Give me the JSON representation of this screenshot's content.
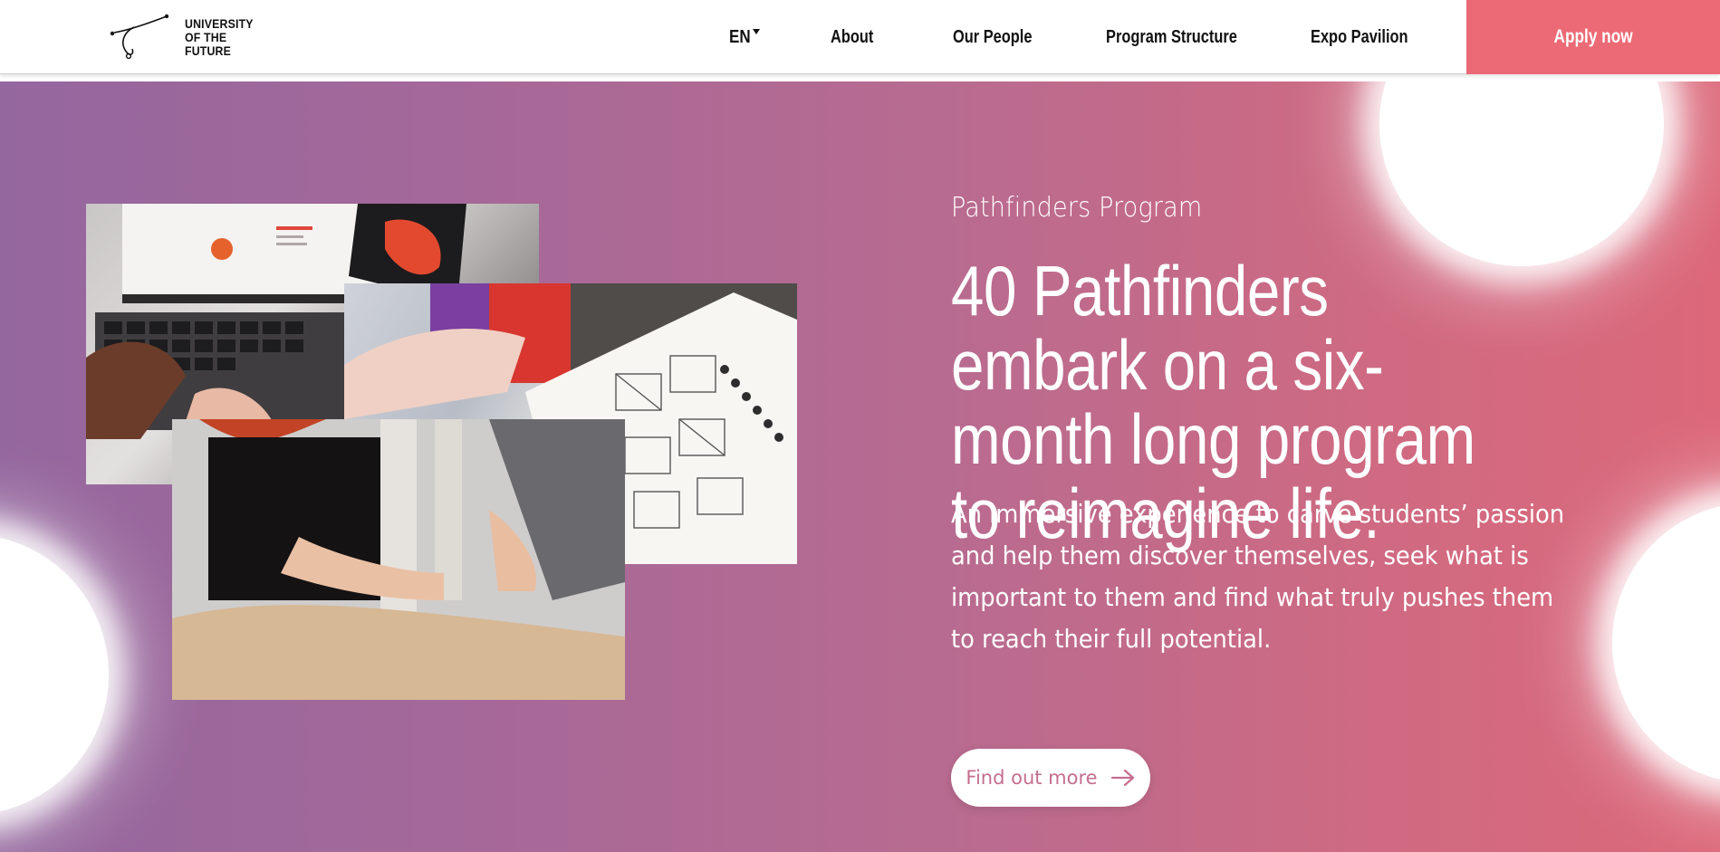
{
  "header": {
    "logo_lines": [
      "UNIVERSITY",
      "OF THE",
      "FUTURE"
    ],
    "language": "EN",
    "nav": [
      "About",
      "Our People",
      "Program Structure",
      "Expo Pavilion"
    ],
    "cta": "Apply now"
  },
  "hero": {
    "eyebrow": "Pathfinders Program",
    "headline": "40 Pathfinders embark on a six-month long program to reimagine life.",
    "lead": "An immersive experience to carve students’ passion and help them discover themselves, seek what is important to them and find what truly pushes them to reach their full potential.",
    "button": "Find out more"
  },
  "colors": {
    "accent": "#ec6a75",
    "gradient_start": "#94679e",
    "gradient_end": "#dc687a",
    "button_text": "#c56e8f"
  }
}
